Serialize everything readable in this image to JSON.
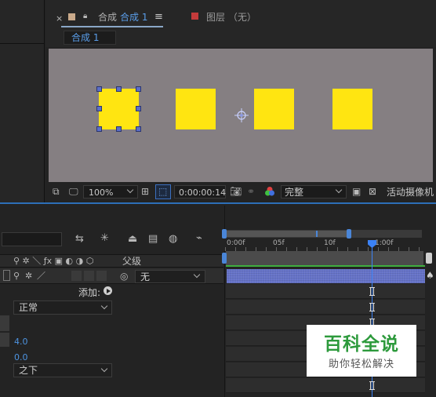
{
  "comp_panel": {
    "close_glyph": "×",
    "tab_prefix": "合成",
    "tab_name": "合成 1",
    "menu_glyph": "≡",
    "layer_tab_label": "图层 （无）",
    "subtab_label": "合成 1",
    "tab_color": "#c9a98a",
    "layer_color": "#c43b3b"
  },
  "viewer_bar": {
    "zoom": "100%",
    "timecode": "0:00:00:14",
    "resolution": "完整",
    "camera": "活动摄像机"
  },
  "timeline": {
    "header_parent_label": "父级",
    "layer_parent_value": "无",
    "add_label": "添加:",
    "blend_mode": "正常",
    "value_a": "4.0",
    "value_b": "0.0",
    "below_mode": "之下",
    "ruler_labels": [
      "0:00f",
      "05f",
      "10f",
      "1:00f"
    ]
  },
  "watermark": {
    "title": "百科全说",
    "subtitle": "助你轻松解决"
  }
}
